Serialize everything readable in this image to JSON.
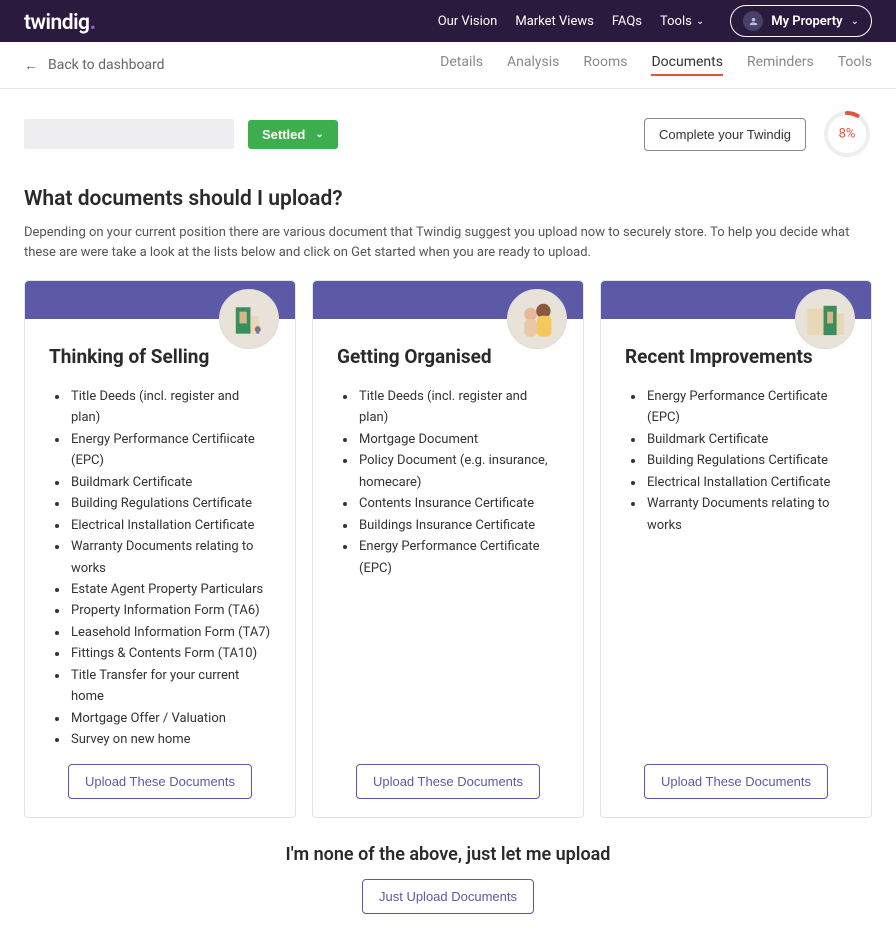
{
  "brand": "twindig",
  "nav": {
    "vision": "Our Vision",
    "market": "Market Views",
    "faqs": "FAQs",
    "tools": "Tools",
    "myprop": "My Property"
  },
  "subnav": {
    "back": "Back to dashboard",
    "tabs": {
      "details": "Details",
      "analysis": "Analysis",
      "rooms": "Rooms",
      "documents": "Documents",
      "reminders": "Reminders",
      "tools": "Tools"
    }
  },
  "status": {
    "settled": "Settled",
    "complete": "Complete your Twindig",
    "progress_pct": "8%",
    "progress_val": 8
  },
  "heading": "What documents should I upload?",
  "desc": "Depending on your current position there are various document that Twindig suggest you upload now to securely store. To help you decide what these are were take a look at the lists below and click on Get started when you are ready to upload.",
  "cards": [
    {
      "title": "Thinking of Selling",
      "items": [
        "Title Deeds (incl. register and plan)",
        "Energy Performance Certifiicate (EPC)",
        "Buildmark Certificate",
        "Building Regulations Certificate",
        "Electrical Installation Certificate",
        "Warranty Documents relating to works",
        "Estate Agent Property Particulars",
        "Property Information Form (TA6)",
        "Leasehold Information Form (TA7)",
        "Fittings & Contents Form (TA10)",
        "Title Transfer for your current home",
        "Mortgage Offer / Valuation",
        "Survey on new home"
      ],
      "btn": "Upload These Documents"
    },
    {
      "title": "Getting Organised",
      "items": [
        "Title Deeds (incl. register and plan)",
        "Mortgage Document",
        "Policy Document (e.g. insurance, homecare)",
        "Contents Insurance Certificate",
        "Buildings Insurance Certificate",
        "Energy Performance Certificate (EPC)"
      ],
      "btn": "Upload These Documents"
    },
    {
      "title": "Recent Improvements",
      "items": [
        "Energy Performance Certificate (EPC)",
        "Buildmark Certificate",
        "Building Regulations Certificate",
        "Electrical Installation Certificate",
        "Warranty Documents relating to works"
      ],
      "btn": "Upload These Documents"
    }
  ],
  "fallback": {
    "text": "I'm none of the above, just let me upload",
    "btn": "Just Upload Documents"
  }
}
